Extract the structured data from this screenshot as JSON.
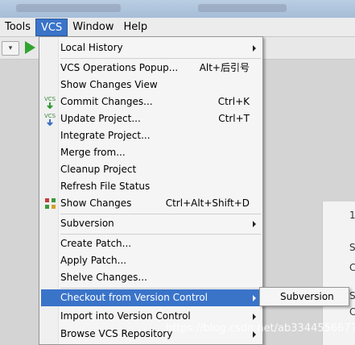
{
  "menubar": {
    "items": [
      {
        "label": "Tools",
        "active": false
      },
      {
        "label": "VCS",
        "active": true
      },
      {
        "label": "Window",
        "active": false
      },
      {
        "label": "Help",
        "active": false
      }
    ]
  },
  "vcs_menu": {
    "local_history": "Local History",
    "operations_popup": "VCS Operations Popup...",
    "operations_popup_shortcut": "Alt+后引号",
    "show_changes_view": "Show Changes View",
    "commit_changes": "Commit Changes...",
    "commit_changes_shortcut": "Ctrl+K",
    "update_project": "Update Project...",
    "update_project_shortcut": "Ctrl+T",
    "integrate_project": "Integrate Project...",
    "merge_from": "Merge from...",
    "cleanup_project": "Cleanup Project",
    "refresh_file_status": "Refresh File Status",
    "show_changes": "Show Changes",
    "show_changes_shortcut": "Ctrl+Alt+Shift+D",
    "subversion": "Subversion",
    "create_patch": "Create Patch...",
    "apply_patch": "Apply Patch...",
    "shelve_changes": "Shelve Changes...",
    "checkout": "Checkout from Version Control",
    "import": "Import into Version Control",
    "browse": "Browse VCS Repository"
  },
  "checkout_submenu": {
    "subversion": "Subversion"
  },
  "icons": {
    "vcs_badge": "VCS",
    "commit": "commit-icon",
    "update": "update-icon",
    "show_changes": "diff-icon"
  },
  "watermark": "https://blog.csdn.net/ab3344556677",
  "colors": {
    "highlight": "#3a74c9",
    "menu_bg": "#f5f5f5",
    "run_green": "#2fa52f"
  }
}
